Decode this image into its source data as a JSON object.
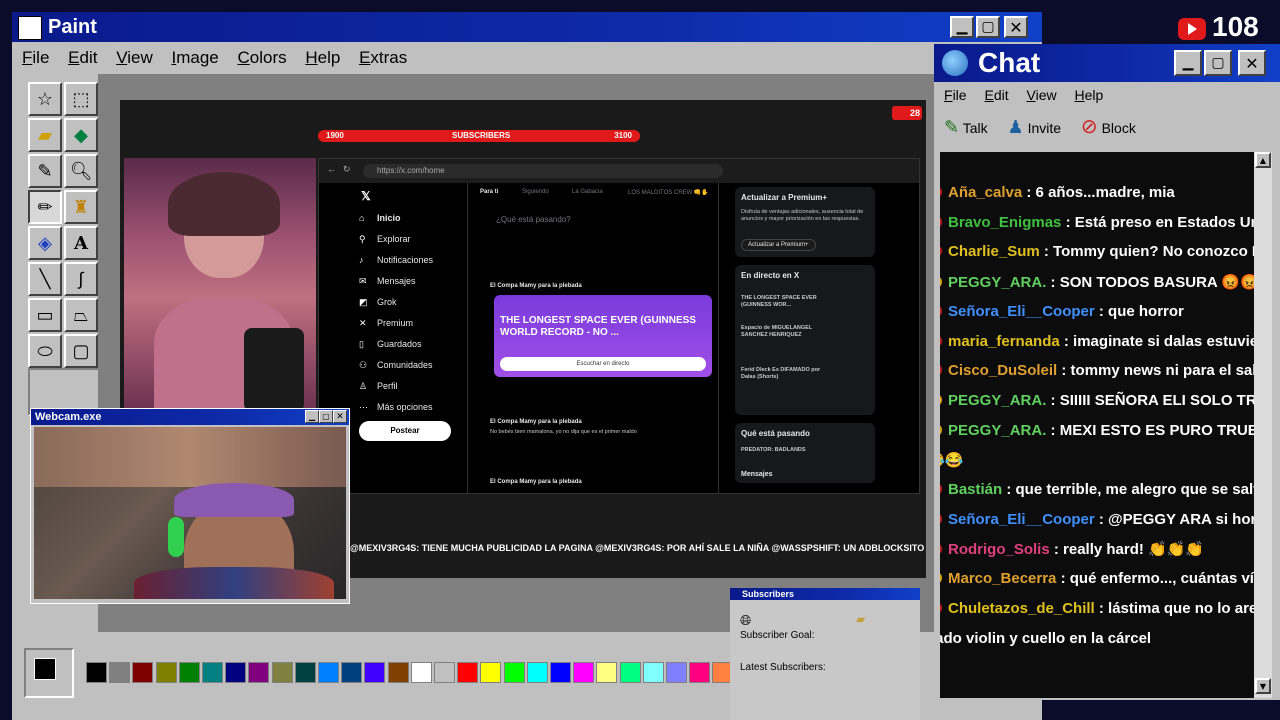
{
  "paint": {
    "title": "Paint",
    "menu": [
      "File",
      "Edit",
      "View",
      "Image",
      "Colors",
      "Help",
      "Extras"
    ],
    "palette_colors": [
      "#000000",
      "#808080",
      "#800000",
      "#808000",
      "#008000",
      "#008080",
      "#000080",
      "#800080",
      "#808040",
      "#004040",
      "#0080ff",
      "#004080",
      "#4000ff",
      "#804000",
      "#ffffff",
      "#c0c0c0",
      "#ff0000",
      "#ffff00",
      "#00ff00",
      "#00ffff",
      "#0000ff",
      "#ff00ff",
      "#ffff80",
      "#00ff80",
      "#80ffff",
      "#8080ff",
      "#ff0080",
      "#ff8040"
    ]
  },
  "stream": {
    "sub_goal_left": "1900",
    "sub_goal_label": "SUBSCRIBERS",
    "sub_goal_right": "3100",
    "yt_count": "28",
    "ticker": "@MEXIV3RG4S: TIENE MUCHA PUBLICIDAD LA PAGINA  @MEXIV3RG4S: POR AHÍ SALE LA NIÑA  @WASSPSHIFT: UN ADBLOCKSITO"
  },
  "x_browser": {
    "url": "https://x.com/home",
    "nav": [
      "Inicio",
      "Explorar",
      "Notificaciones",
      "Mensajes",
      "Grok",
      "Premium",
      "Guardados",
      "Comunidades",
      "Perfil",
      "Más opciones"
    ],
    "post_button": "Postear",
    "tabs": [
      "Para ti",
      "Siguiendo",
      "La Gabacia",
      "LOS MALDITOS CREW 👊✋"
    ],
    "compose_placeholder": "¿Qué está pasando?",
    "post_author": "El Compa Mamy para la plebada",
    "purple_card_title": "THE LONGEST SPACE EVER (GUINNESS WORLD RECORD - NO ...",
    "purple_card_button": "Escuchar en directo",
    "post2_text": "No bebés bien mamalona, yo no dija que es el primer maldo",
    "premium_title": "Actualizar a Premium+",
    "premium_text": "Disfruta de ventajas adicionales, ausencia total de anuncios y mayor priorización en las respuestas.",
    "premium_button": "Actualizar a Premium+",
    "live_title": "En directo en X",
    "live_items": [
      "THE LONGEST SPACE EVER (GUINNESS WOR...",
      "Espacio de MIGUELANGEL SANCHEZ HENRIQUEZ",
      "Ferid Dleck Es DIFAMADO por Dalas (Shorts)"
    ],
    "trending_title": "Qué está pasando",
    "trending_item": "PREDATOR: BADLANDS",
    "messages_label": "Mensajes"
  },
  "webcam": {
    "title": "Webcam.exe"
  },
  "chat": {
    "title": "Chat",
    "menu": [
      "File",
      "Edit",
      "View",
      "Help"
    ],
    "tools": [
      {
        "label": "Talk",
        "icon": "talk-icon"
      },
      {
        "label": "Invite",
        "icon": "invite-icon"
      },
      {
        "label": "Block",
        "icon": "block-icon"
      }
    ],
    "messages": [
      {
        "user": "Aña_calva",
        "color": "#e0a030",
        "text": ": 6 años...madre, mia",
        "badge": "dot"
      },
      {
        "user": "Bravo_Enigmas",
        "color": "#40c040",
        "text": ": Está preso en Estados Unido",
        "badge": "dot"
      },
      {
        "user": "Charlie_Sum",
        "color": "#e0c020",
        "text": ": Tommy quien? No conozco NPC",
        "badge": "dot"
      },
      {
        "user": "PEGGY_ARA.",
        "color": "#60d060",
        "text": ": SON TODOS BASURA 😡😡",
        "badge": "star"
      },
      {
        "user": "Señora_Eli__Cooper",
        "color": "#4090ff",
        "text": ": que horror",
        "badge": "dot"
      },
      {
        "user": "maria_fernanda",
        "color": "#e0c020",
        "text": ": imaginate si dalas estuviera",
        "badge": "dot"
      },
      {
        "user": "Cisco_DuSoleil",
        "color": "#e0a030",
        "text": ": tommy news ni para el salsec",
        "badge": "dot"
      },
      {
        "user": "PEGGY_ARA.",
        "color": "#60d060",
        "text": ": SIIIII SEÑORA ELI SOLO TRU",
        "badge": "star"
      },
      {
        "user": "PEGGY_ARA.",
        "color": "#60d060",
        "text": ": MEXI ESTO ES PURO TRUE C",
        "badge": "star"
      },
      {
        "user": "",
        "color": "#ffffff",
        "text": "😂😂",
        "badge": ""
      },
      {
        "user": "Bastián",
        "color": "#60d060",
        "text": ": que terrible, me alegro que se salvar",
        "badge": "dot"
      },
      {
        "user": "Señora_Eli__Cooper",
        "color": "#4090ff",
        "text": ": @PEGGY ARA si horrible",
        "badge": "dot"
      },
      {
        "user": "Rodrigo_Solis",
        "color": "#e04080",
        "text": ": really hard! 👏👏👏",
        "badge": "dot"
      },
      {
        "user": "Marco_Becerra",
        "color": "#e0a030",
        "text": ": qué enfermo..., cuántas víc",
        "badge": "star"
      },
      {
        "user": "Chuletazos_de_Chill",
        "color": "#e0c020",
        "text": ": lástima que no lo aresta",
        "badge": "dot"
      },
      {
        "user": "",
        "color": "#ffffff",
        "text": "dado violin y cuello en la cárcel",
        "badge": ""
      }
    ]
  },
  "subscribers": {
    "title": "Subscribers",
    "goal_label": "Subscriber Goal:",
    "latest_label": "Latest Subscribers:"
  },
  "overlay": {
    "viewer_count": "108"
  }
}
